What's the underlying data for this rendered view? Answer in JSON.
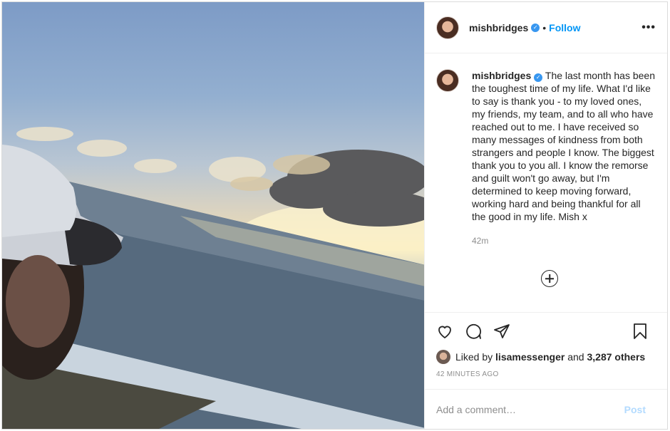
{
  "post": {
    "username": "mishbridges",
    "follow_label": "Follow",
    "separator": "•",
    "more_label": "•••",
    "caption": "The last month has been the toughest time of my life. What I'd like to say is thank you - to my loved ones, my friends, my team, and to all who have reached out to me. I have received so many messages of kindness from both strangers and people I know. The biggest thank you to you all. I know the remorse and guilt won't go away, but I'm determined to keep moving forward, working hard and being thankful for all the good in my life. Mish x",
    "caption_time": "42m",
    "likes": {
      "prefix": "Liked by",
      "liker": "lisamessenger",
      "connector": "and",
      "count": "3,287 others"
    },
    "posted_ago": "42 MINUTES AGO",
    "comment_placeholder": "Add a comment…",
    "post_label": "Post"
  },
  "colors": {
    "accent": "#0095f6",
    "verified": "#3897f0",
    "muted": "#8e8e8e",
    "post_disabled": "#b3dbff"
  },
  "icons": [
    "verified-badge-icon",
    "more-options-icon",
    "plus-circle-icon",
    "heart-icon",
    "comment-icon",
    "share-icon",
    "bookmark-icon"
  ]
}
